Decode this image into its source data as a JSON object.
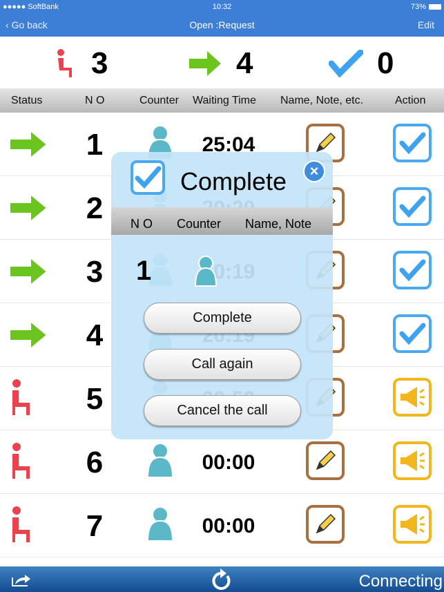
{
  "status_bar": {
    "carrier": "●●●●● SoftBank",
    "time": "10:32",
    "battery": "73%"
  },
  "nav": {
    "back": "Go back",
    "title": "Open :Request",
    "edit": "Edit"
  },
  "summary": {
    "waiting": "3",
    "called": "4",
    "completed": "0"
  },
  "columns": [
    "Status",
    "N O",
    "Counter",
    "Waiting Time",
    "Name, Note, etc.",
    "Action"
  ],
  "rows": [
    {
      "status": "arrow",
      "no": "1",
      "time": "25:04",
      "action": "check"
    },
    {
      "status": "arrow",
      "no": "2",
      "time": "20:20",
      "action": "check"
    },
    {
      "status": "arrow",
      "no": "3",
      "time": "20:19",
      "action": "check"
    },
    {
      "status": "arrow",
      "no": "4",
      "time": "20:19",
      "action": "check"
    },
    {
      "status": "seat",
      "no": "5",
      "time": "00:59",
      "action": "megaphone"
    },
    {
      "status": "seat",
      "no": "6",
      "time": "00:00",
      "action": "megaphone"
    },
    {
      "status": "seat",
      "no": "7",
      "time": "00:00",
      "action": "megaphone"
    }
  ],
  "modal": {
    "title": "Complete",
    "columns": [
      "N O",
      "Counter",
      "Name, Note"
    ],
    "no": "1",
    "buttons": [
      "Complete",
      "Call again",
      "Cancel the call"
    ]
  },
  "bottom": {
    "status": "Connecting"
  },
  "colors": {
    "nav": "#3d7fd6",
    "arrow": "#6cc51f",
    "seat": "#e8434f",
    "check": "#3ea3ee",
    "counter": "#5bb8c8"
  }
}
